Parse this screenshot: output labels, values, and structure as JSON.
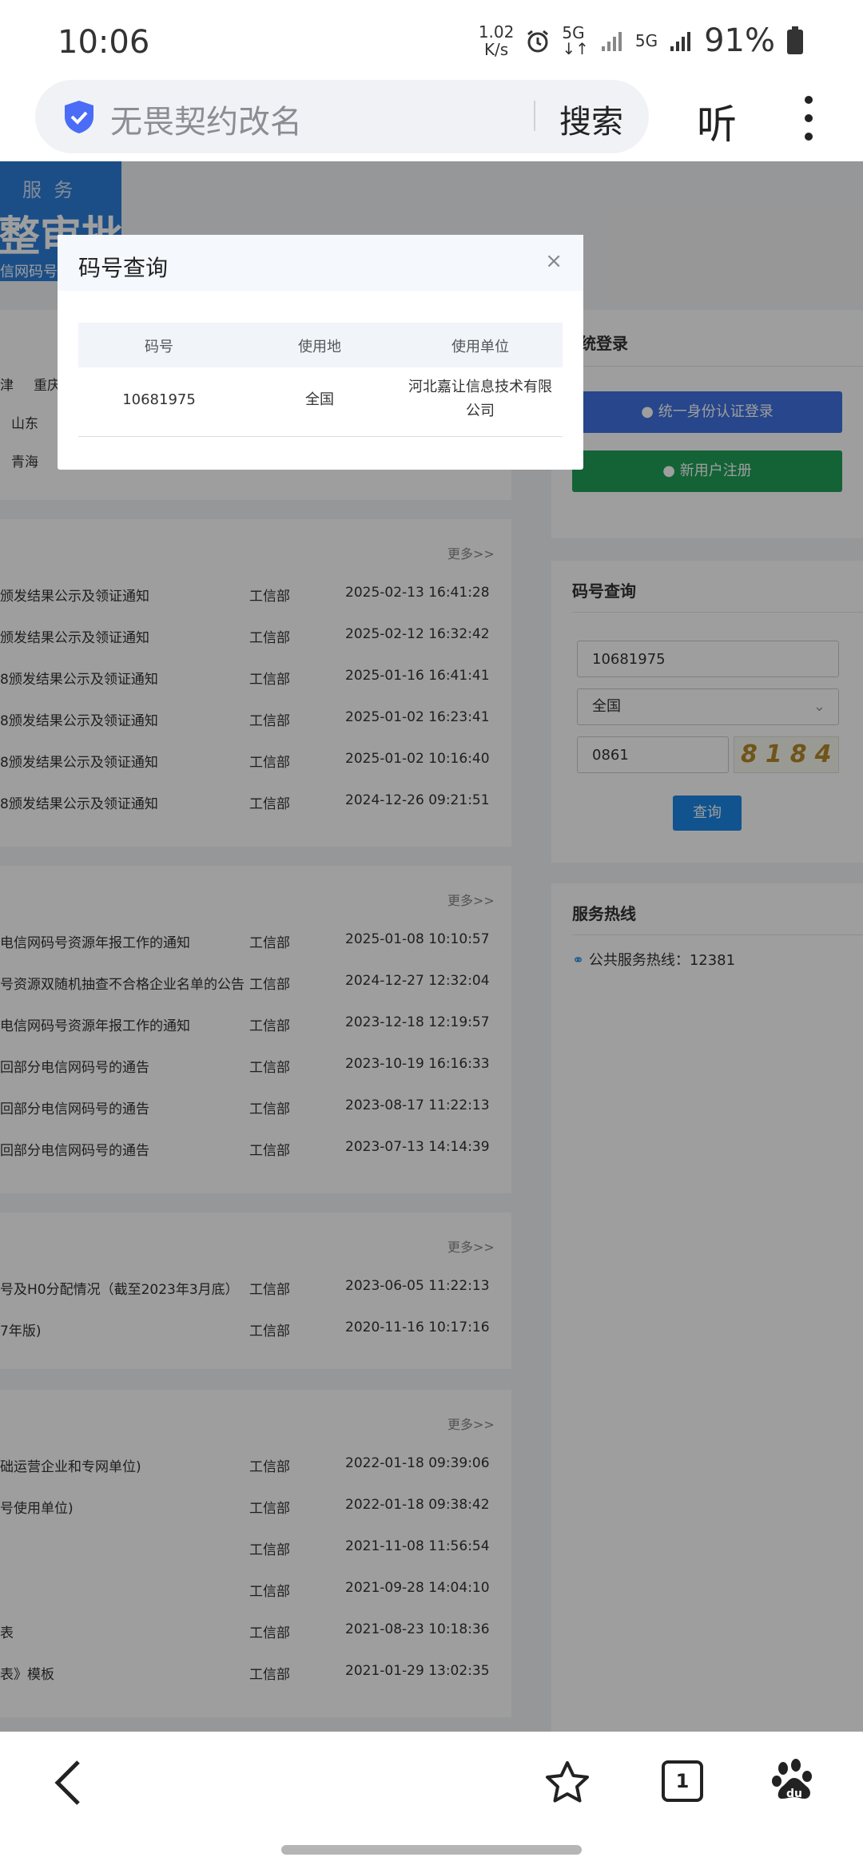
{
  "status": {
    "time": "10:06",
    "speed_value": "1.02",
    "speed_unit": "K/s",
    "net1": "5G",
    "net2": "5G",
    "battery": "91%"
  },
  "urlbar": {
    "query": "无畏契约改名",
    "search_label": "搜索",
    "listen_label": "听"
  },
  "banner": {
    "top_text": "服  务",
    "big_text": "整审批",
    "small_text": "信网码号资源"
  },
  "side_tags": {
    "r1a": "津",
    "r1b": "重庆",
    "r2": "山东",
    "r3": "青海"
  },
  "login": {
    "title": "系统登录",
    "auth_btn": "统一身份认证登录",
    "register_btn": "新用户注册"
  },
  "query_panel": {
    "title": "码号查询",
    "number": "10681975",
    "region": "全国",
    "captcha_input": "0861",
    "captcha_text": "8184",
    "query_btn": "查询"
  },
  "hotline": {
    "title": "服务热线",
    "text": "公共服务热线：12381"
  },
  "more_label": "更多>>",
  "sections": [
    {
      "rows": [
        {
          "title": "颁发结果公示及领证通知",
          "dept": "工信部",
          "time": "2025-02-13 16:41:28"
        },
        {
          "title": "颁发结果公示及领证通知",
          "dept": "工信部",
          "time": "2025-02-12 16:32:42"
        },
        {
          "title": "8颁发结果公示及领证通知",
          "dept": "工信部",
          "time": "2025-01-16 16:41:41"
        },
        {
          "title": "8颁发结果公示及领证通知",
          "dept": "工信部",
          "time": "2025-01-02 16:23:41"
        },
        {
          "title": "8颁发结果公示及领证通知",
          "dept": "工信部",
          "time": "2025-01-02 10:16:40"
        },
        {
          "title": "8颁发结果公示及领证通知",
          "dept": "工信部",
          "time": "2024-12-26 09:21:51"
        }
      ]
    },
    {
      "rows": [
        {
          "title": "电信网码号资源年报工作的通知",
          "dept": "工信部",
          "time": "2025-01-08 10:10:57"
        },
        {
          "title": "号资源双随机抽查不合格企业名单的公告",
          "dept": "工信部",
          "time": "2024-12-27 12:32:04"
        },
        {
          "title": "电信网码号资源年报工作的通知",
          "dept": "工信部",
          "time": "2023-12-18 12:19:57"
        },
        {
          "title": "回部分电信网码号的通告",
          "dept": "工信部",
          "time": "2023-10-19 16:16:33"
        },
        {
          "title": "回部分电信网码号的通告",
          "dept": "工信部",
          "time": "2023-08-17 11:22:13"
        },
        {
          "title": "回部分电信网码号的通告",
          "dept": "工信部",
          "time": "2023-07-13 14:14:39"
        }
      ]
    },
    {
      "rows": [
        {
          "title": "号及H0分配情况（截至2023年3月底）",
          "dept": "工信部",
          "time": "2023-06-05 11:22:13"
        },
        {
          "title": "7年版)",
          "dept": "工信部",
          "time": "2020-11-16 10:17:16"
        }
      ]
    },
    {
      "rows": [
        {
          "title": "础运营企业和专网单位)",
          "dept": "工信部",
          "time": "2022-01-18 09:39:06"
        },
        {
          "title": "号使用单位)",
          "dept": "工信部",
          "time": "2022-01-18 09:38:42"
        },
        {
          "title": "",
          "dept": "工信部",
          "time": "2021-11-08 11:56:54"
        },
        {
          "title": "",
          "dept": "工信部",
          "time": "2021-09-28 14:04:10"
        },
        {
          "title": "表",
          "dept": "工信部",
          "time": "2021-08-23 10:18:36"
        },
        {
          "title": "表》模板",
          "dept": "工信部",
          "time": "2021-01-29 13:02:35"
        }
      ]
    }
  ],
  "modal": {
    "title": "码号查询",
    "close": "×",
    "headers": [
      "码号",
      "使用地",
      "使用单位"
    ],
    "row": {
      "number": "10681975",
      "region": "全国",
      "unit_line1": "河北嘉让信息技术有限",
      "unit_line2": "公司"
    }
  },
  "bottom": {
    "tab_count": "1"
  }
}
